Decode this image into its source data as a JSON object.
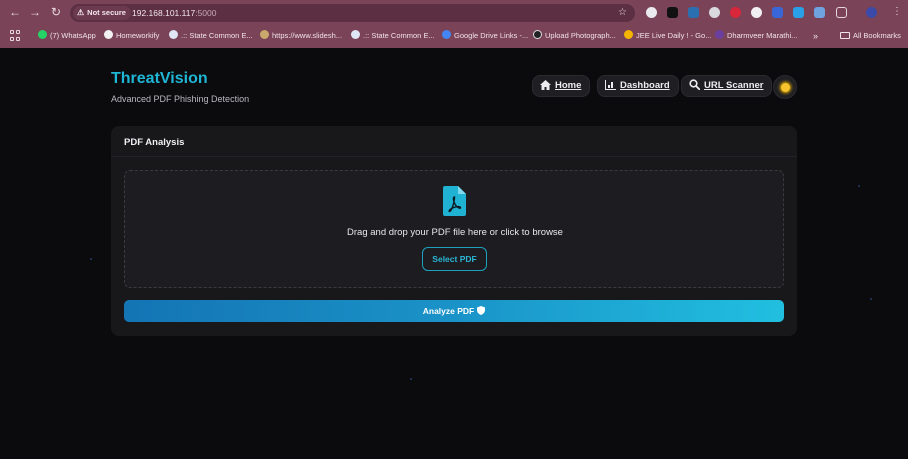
{
  "browser": {
    "security_label": "Not secure",
    "url_host": "192.168.101.117",
    "url_port": ":5000",
    "bookmarks": [
      "(7) WhatsApp",
      "Homeworkify",
      ".:: State Common E...",
      "https://www.slidesh...",
      ".:: State Common E...",
      "Google Drive Links -...",
      "Upload Photograph...",
      "JEE Live Daily ! - Go...",
      "Dharmveer Marathi..."
    ],
    "more_label": "»",
    "all_bookmarks_label": "All Bookmarks"
  },
  "app": {
    "brand": "ThreatVision",
    "tagline": "Advanced PDF Phishing Detection",
    "nav": {
      "home": "Home",
      "dashboard": "Dashboard",
      "url_scanner": "URL Scanner"
    }
  },
  "card": {
    "title": "PDF Analysis",
    "drop_text": "Drag and drop your PDF file here or click to browse",
    "select_label": "Select PDF",
    "analyze_label": "Analyze PDF"
  },
  "colors": {
    "accent": "#1fb6d6",
    "chrome": "#7a4358",
    "background": "#0b0b0d"
  }
}
